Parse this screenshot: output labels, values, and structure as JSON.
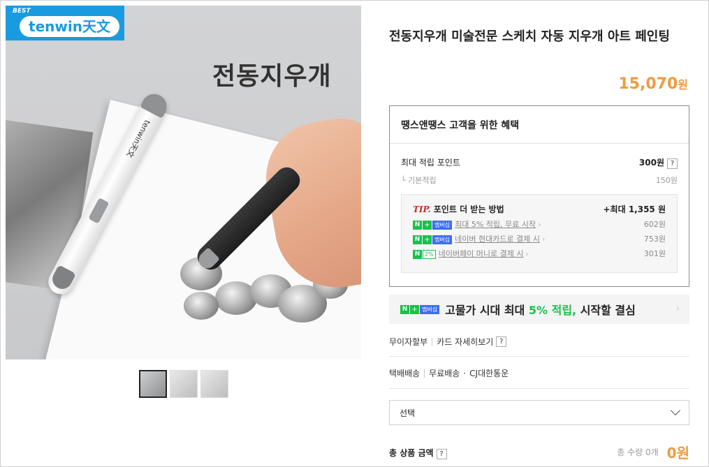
{
  "badge": {
    "best_label": "BEST",
    "logo_text": "tenwin天文"
  },
  "hero": {
    "title": "전동지우개",
    "pen_brand": "tenwin天文"
  },
  "thumbnails": [
    {
      "name": "thumb-1",
      "active": true
    },
    {
      "name": "thumb-2",
      "active": false
    },
    {
      "name": "thumb-3",
      "active": false
    }
  ],
  "product": {
    "title": "전동지우개 미술전문 스케치 자동 지우개 아트 페인팅",
    "price": "15,070",
    "price_unit": "원"
  },
  "benefit": {
    "heading": "땡스앤땡스 고객을 위한 혜택",
    "max_points_label": "최대 적립 포인트",
    "max_points_value": "300원",
    "qmark": "?",
    "base_label": "└ 기본적립",
    "base_value": "150원",
    "tip": {
      "word": "TIP.",
      "label": "포인트 더 받는 방법",
      "max_extra": "+최대 1,355 원",
      "items": [
        {
          "badge_n": "N",
          "badge_plus": "+",
          "badge_tag": "멤버십",
          "text": "최대 5% 적립, 무료 시작",
          "value": "602원"
        },
        {
          "badge_n": "N",
          "badge_plus": "+",
          "badge_tag": "멤버십",
          "text": "네이버 현대카드로 결제 시",
          "value": "753원"
        },
        {
          "badge_n": "N",
          "badge_tag": "2%",
          "text": "네이버페이 머니로 결제 시",
          "value": "301원"
        }
      ],
      "chevron": "›"
    }
  },
  "banner": {
    "badge_n": "N",
    "badge_plus": "+",
    "badge_tag": "멤버십",
    "text_a": "고물가 시대 최대 ",
    "text_hl": "5% 적립,",
    "text_b": " 시작할 결심",
    "chevron": "›"
  },
  "payment": {
    "installment": "무이자할부",
    "card_detail": "카드 자세히보기",
    "qmark": "?"
  },
  "shipping": {
    "type": "택배배송",
    "fee": "무료배송",
    "dot": "·",
    "carrier": "CJ대한통운"
  },
  "option_select": {
    "value": "선택"
  },
  "total": {
    "label": "총 상품 금액",
    "qmark": "?",
    "qty": "총 수량 0개",
    "amount": "0원"
  },
  "colors": {
    "accent": "#f09a3e",
    "naver_green": "#19c04a",
    "best_blue": "#1a9be0"
  }
}
